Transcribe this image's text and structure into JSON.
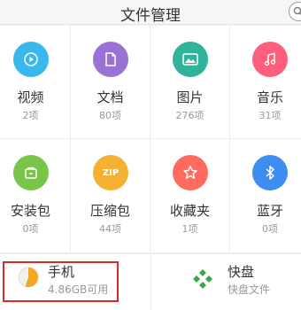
{
  "header": {
    "title": "文件管理",
    "search_icon": "search-icon"
  },
  "categories": [
    {
      "name": "视频",
      "count": "2项",
      "color": "#39b8ee",
      "icon": "play-icon"
    },
    {
      "name": "文档",
      "count": "80项",
      "color": "#9a72d6",
      "icon": "document-icon"
    },
    {
      "name": "图片",
      "count": "276项",
      "color": "#2fb39a",
      "icon": "image-icon"
    },
    {
      "name": "音乐",
      "count": "31项",
      "color": "#ff5f7c",
      "icon": "music-icon"
    },
    {
      "name": "安装包",
      "count": "0项",
      "color": "#7bc44a",
      "icon": "package-icon"
    },
    {
      "name": "压缩包",
      "count": "44项",
      "color": "#f5b132",
      "icon": "zip-icon",
      "icon_text": "ZIP"
    },
    {
      "name": "收藏夹",
      "count": "1项",
      "color": "#ff6b5e",
      "icon": "star-icon"
    },
    {
      "name": "蓝牙",
      "count": "0项",
      "color": "#3d8ef0",
      "icon": "bluetooth-icon"
    }
  ],
  "storage": {
    "phone": {
      "name": "手机",
      "sub": "4.86GB可用",
      "used_fraction": 0.55,
      "color": "#f5a623"
    },
    "quick": {
      "name": "快盘",
      "sub": "快盘文件",
      "color": "#3aa64a"
    }
  },
  "annotation": {
    "color": "#d62b2b"
  }
}
